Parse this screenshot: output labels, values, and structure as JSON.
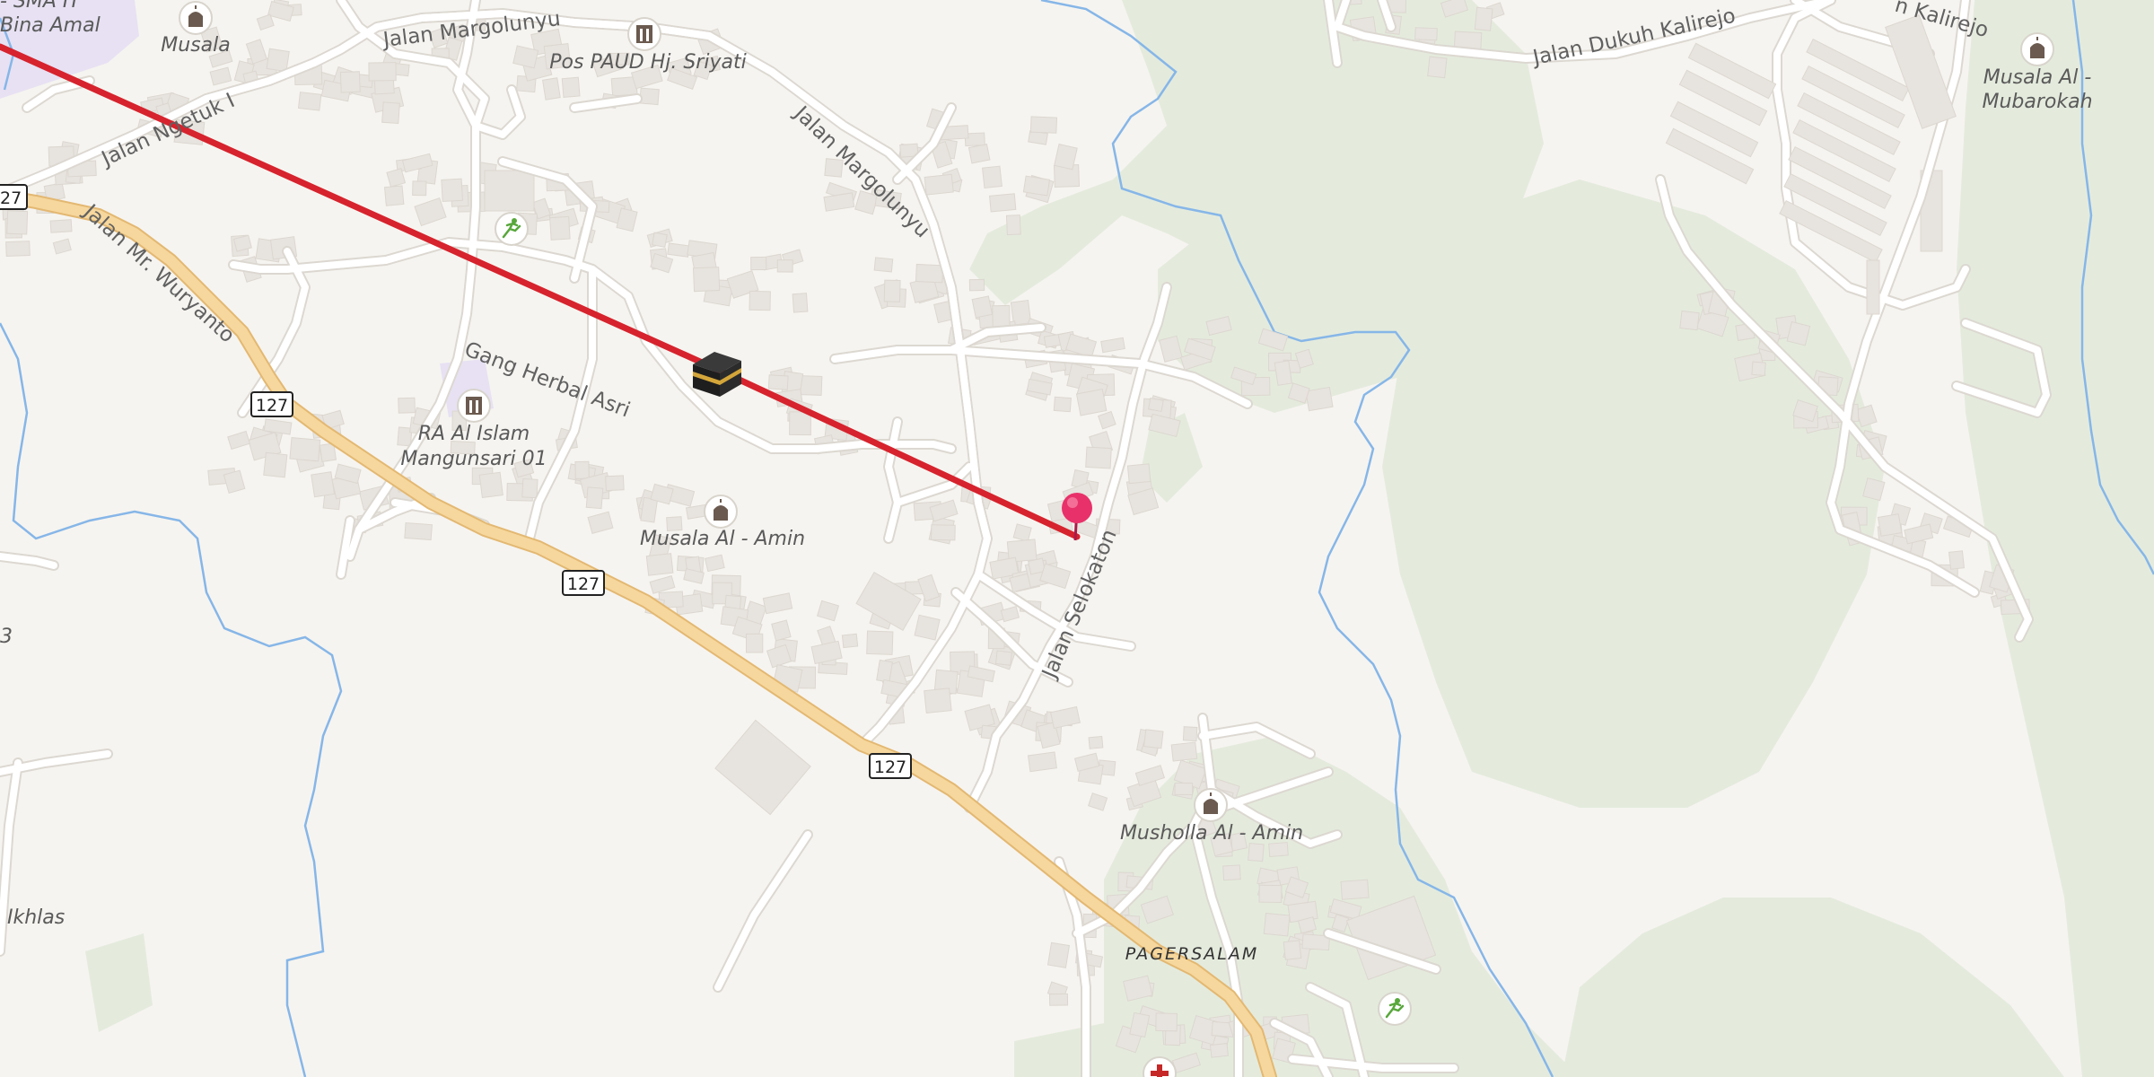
{
  "map": {
    "roads": {
      "jalan_margolunyu_1": "Jalan Margolunyu",
      "jalan_margolunyu_2": "Jalan Margolunyu",
      "jalan_ngetuk": "Jalan Ngetuk I",
      "jalan_mr_wuryanto": "Jalan Mr. Wuryanto",
      "gang_herbal_asri": "Gang Herbal Asri",
      "jalan_selokaton": "Jalan Selokaton",
      "jalan_dukuh_kalirejo": "Jalan Dukuh Kalirejo",
      "kalirejo_partial": "n Kalirejo"
    },
    "route_shields": [
      "127",
      "127",
      "127",
      "127",
      "27"
    ],
    "pois": {
      "musala_top": "Musala",
      "sma_partial": "- SMA IT",
      "bina_amal_partial": "Bina Amal",
      "pos_paud": "Pos PAUD Hj. Sriyati",
      "ra_al_islam_1": "RA Al Islam",
      "ra_al_islam_2": "Mangunsari 01",
      "musala_al_amin": "Musala Al - Amin",
      "musholla_al_amin": "Musholla Al - Amin",
      "musala_mubarokah_1": "Musala Al -",
      "musala_mubarokah_2": "Mubarokah",
      "ikhlas_partial": "Ikhlas",
      "edge_partial_3": "3"
    },
    "places": {
      "pagersalam": "PAGERSALAM"
    },
    "colors": {
      "background": "#f6f4f0",
      "road": "#ffffff",
      "road_outline": "#dedbd4",
      "primary_road": "#f6d79d",
      "primary_outline": "#e3b872",
      "building": "#e7e3de",
      "water": "#86b6e8",
      "forest": "#e4ebdd",
      "school_area": "#e7e1f3",
      "route_line": "#d6232d",
      "pin": "#e8316a"
    },
    "icons": [
      "mosque-icon",
      "school-icon",
      "sport-icon",
      "kaaba-icon",
      "map-pin-icon",
      "hospital-icon"
    ]
  }
}
